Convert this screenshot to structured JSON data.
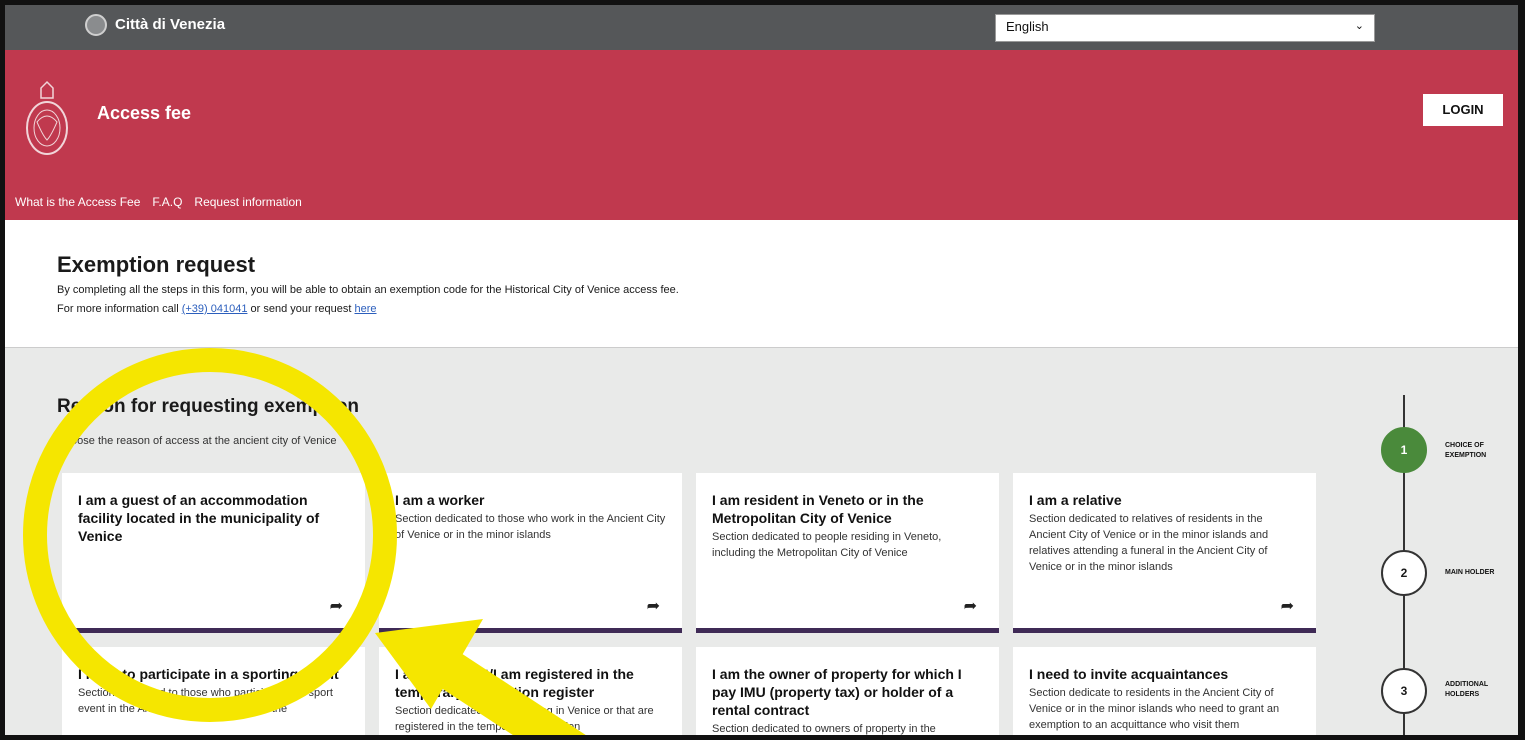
{
  "topbar": {
    "city_name": "Città di Venezia",
    "language_value": "English"
  },
  "header": {
    "title": "Access fee",
    "login_label": "LOGIN",
    "nav": [
      "What is the Access Fee",
      "F.A.Q",
      "Request information"
    ]
  },
  "intro": {
    "heading": "Exemption request",
    "line1": "By completing all the steps in this form, you will be able to obtain an exemption code for the Historical City of Venice access fee.",
    "line2_pre": "For more information call ",
    "phone": "(+39) 041041",
    "line2_mid": " or send your request ",
    "here_link": "here"
  },
  "main": {
    "heading": "Reason for requesting exemption",
    "subheading": "Choose the reason of access at the ancient city of Venice"
  },
  "cards": [
    {
      "title": "I am a guest of an accommodation facility located in the municipality of Venice",
      "desc": ""
    },
    {
      "title": "I am a worker",
      "desc": "Section dedicated to those who work in the Ancient City of Venice or in the minor islands"
    },
    {
      "title": "I am resident in Veneto or in the Metropolitan City of Venice",
      "desc": "Section dedicated to people residing in Veneto, including the Metropolitan City of Venice"
    },
    {
      "title": "I am a relative",
      "desc": "Section dedicated to relatives of residents in the Ancient City of Venice or in the minor islands and relatives attending a funeral in the Ancient City of Venice or in the minor islands"
    },
    {
      "title": "I need to participate in a sporting event",
      "desc": "Section dedicated to those who participate in a sport event in the Ancient City of Venice or in the"
    },
    {
      "title": "I am a student/I am registered in the temporary population register",
      "desc": "Section dedicated to those living in Venice or that are registered in the temporary population"
    },
    {
      "title": "I am the owner of property for which I pay IMU (property tax) or holder of a rental contract",
      "desc": "Section dedicated to owners of property in the"
    },
    {
      "title": "I need to invite acquaintances",
      "desc": "Section dedicate to residents in the Ancient City of Venice or in the minor islands who need to grant an exemption to an acquittance who visit them"
    }
  ],
  "steps": [
    {
      "number": "1",
      "label": "CHOICE OF EXEMPTION"
    },
    {
      "number": "2",
      "label": "MAIN HOLDER"
    },
    {
      "number": "3",
      "label": "ADDITIONAL HOLDERS"
    }
  ],
  "icons": {
    "card_arrow": "share-arrow-icon",
    "select_chevron": "chevron-down-icon"
  },
  "colors": {
    "topbar": "#555759",
    "brand_red": "#c0394e",
    "card_accent": "#3f2a56",
    "step_active": "#4a8a3b",
    "highlight": "#f5e600"
  }
}
